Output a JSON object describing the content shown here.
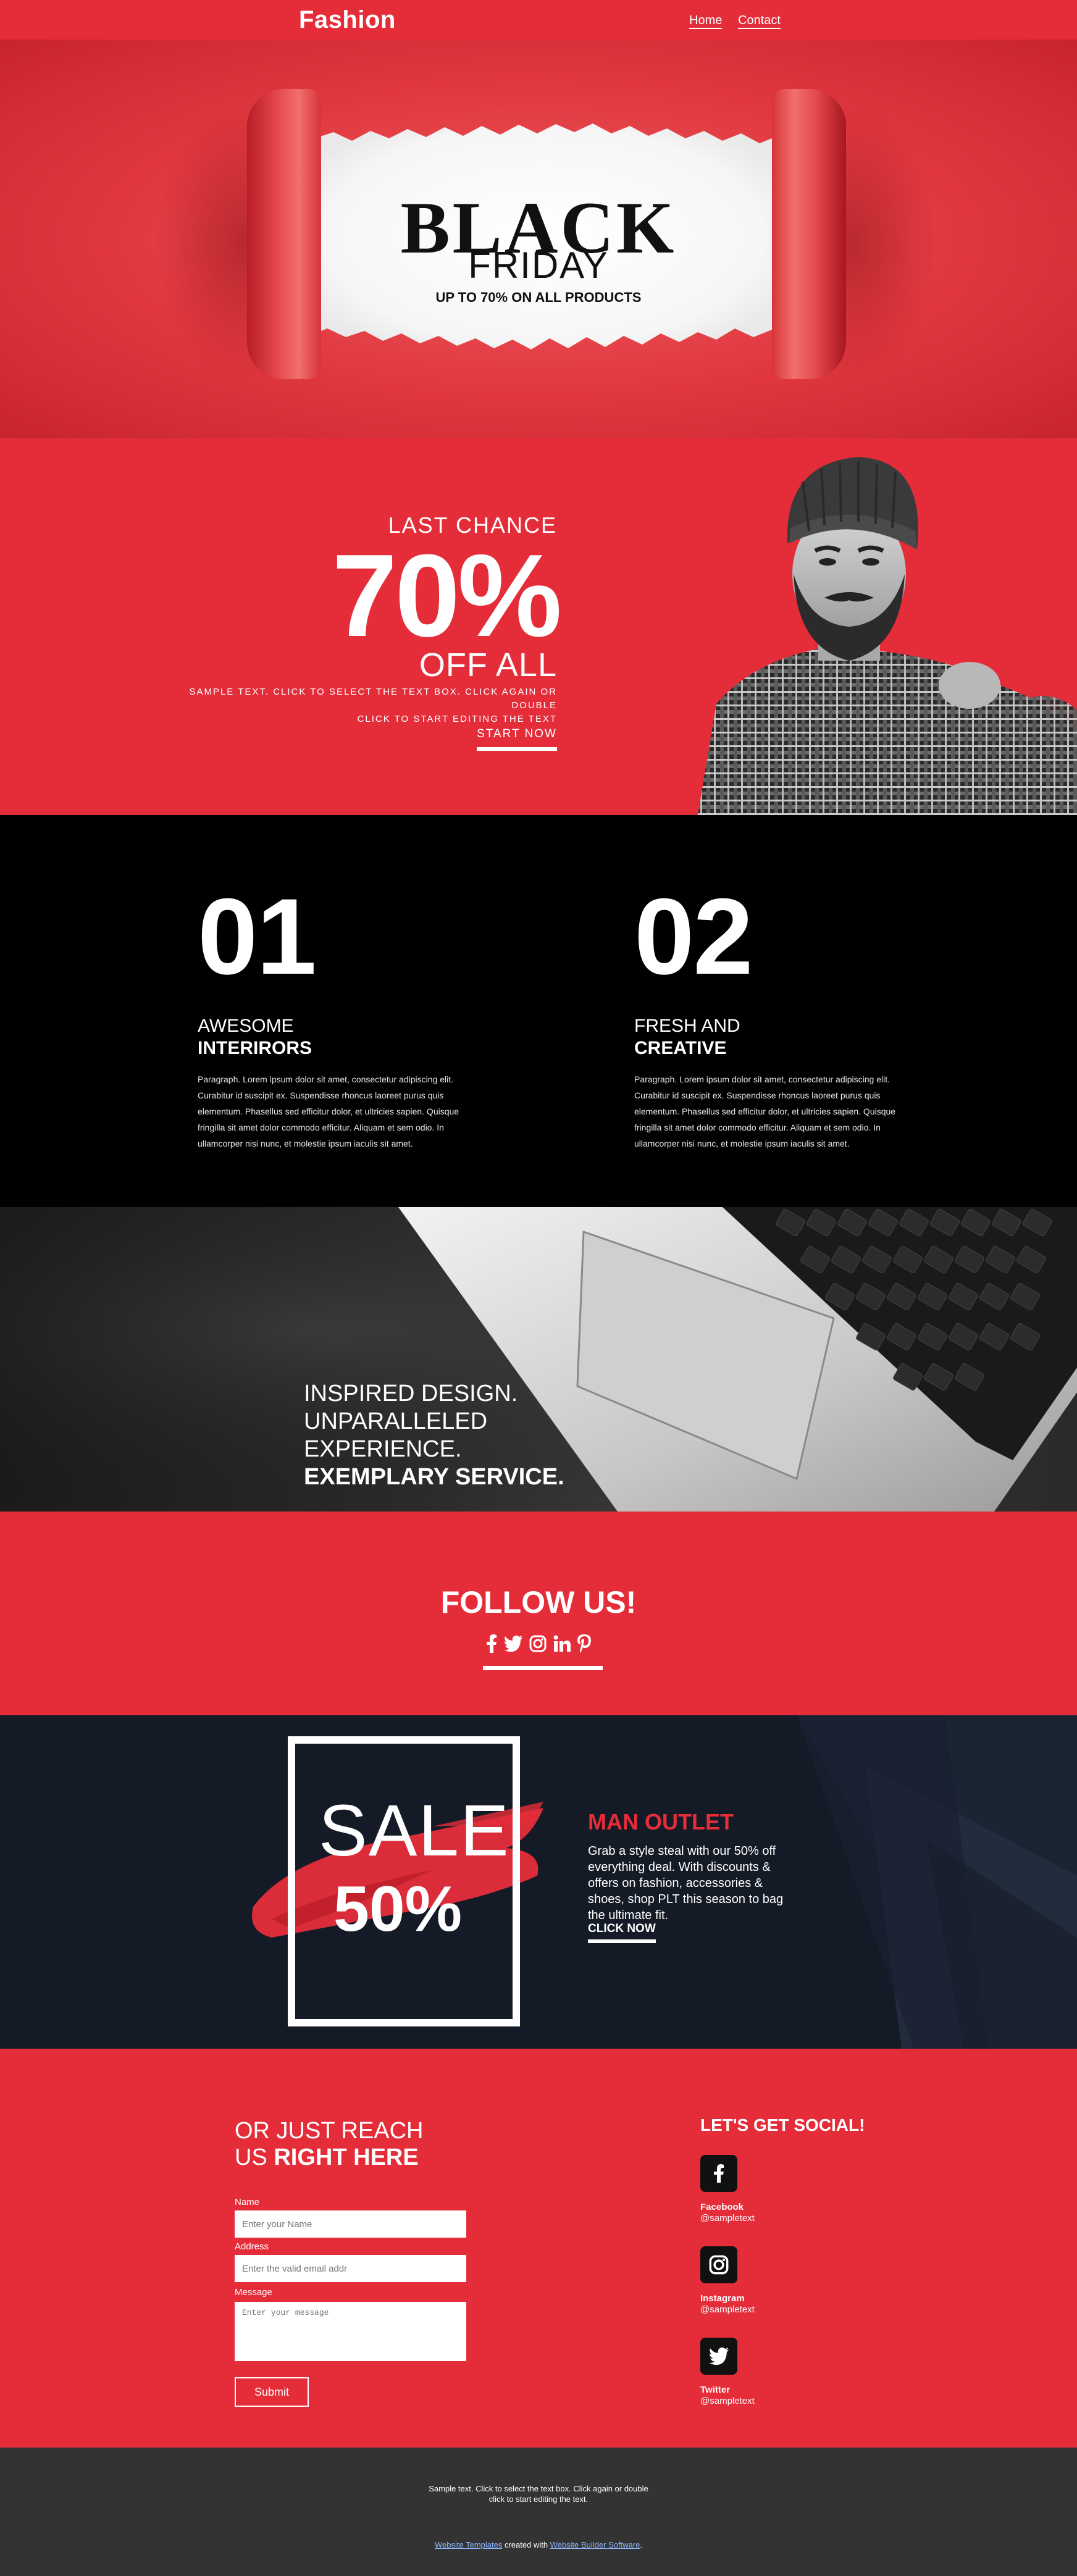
{
  "header": {
    "logo": "Fashion",
    "nav": [
      "Home",
      "Contact"
    ]
  },
  "hero": {
    "title": "BLACK",
    "subtitle": "FRIDAY",
    "tagline": "UP TO 70% ON ALL PRODUCTS"
  },
  "promo": {
    "last_chance": "LAST CHANCE",
    "percent": "70%",
    "off_all": "OFF ALL",
    "text_line1": "SAMPLE TEXT. CLICK TO SELECT THE TEXT BOX. CLICK AGAIN OR DOUBLE",
    "text_line2": "CLICK TO START EDITING THE TEXT",
    "button": "START NOW"
  },
  "features": [
    {
      "number": "01",
      "title1": "AWESOME",
      "title2": "INTERIRORS",
      "paragraph": "Paragraph. Lorem ipsum dolor sit amet, consectetur adipiscing elit. Curabitur id suscipit ex. Suspendisse rhoncus laoreet purus quis elementum. Phasellus sed efficitur dolor, et ultricies sapien. Quisque fringilla sit amet dolor commodo efficitur. Aliquam et sem odio. In ullamcorper nisi nunc, et molestie ipsum iaculis sit amet."
    },
    {
      "number": "02",
      "title1": "FRESH AND",
      "title2": "CREATIVE",
      "paragraph": "Paragraph. Lorem ipsum dolor sit amet, consectetur adipiscing elit. Curabitur id suscipit ex. Suspendisse rhoncus laoreet purus quis elementum. Phasellus sed efficitur dolor, et ultricies sapien. Quisque fringilla sit amet dolor commodo efficitur. Aliquam et sem odio. In ullamcorper nisi nunc, et molestie ipsum iaculis sit amet."
    }
  ],
  "inspired": {
    "line1": "INSPIRED DESIGN.",
    "line2": "UNPARALLELED",
    "line3": "EXPERIENCE.",
    "line4": "EXEMPLARY SERVICE."
  },
  "follow": {
    "title": "FOLLOW US!",
    "icons": [
      "facebook-icon",
      "twitter-icon",
      "instagram-icon",
      "linkedin-icon",
      "pinterest-icon"
    ]
  },
  "sale": {
    "word": "SALE",
    "percent": "50%",
    "title": "MAN OUTLET",
    "text": "Grab a style steal with our 50% off everything deal. With discounts & offers on fashion, accessories & shoes, shop PLT this season to bag the ultimate fit.",
    "button": "CLICK NOW"
  },
  "contact": {
    "heading_line1": "OR JUST REACH",
    "heading_line2_plain": "US ",
    "heading_line2_bold": "RIGHT HERE",
    "name_label": "Name",
    "name_placeholder": "Enter your Name",
    "email_label": "Address",
    "email_placeholder": "Enter the valid email addr",
    "message_label": "Message",
    "message_placeholder": "Enter your message",
    "submit": "Submit",
    "social_title": "LET'S GET SOCIAL!",
    "socials": [
      {
        "name": "Facebook",
        "handle": "@sampletext",
        "icon": "facebook-icon"
      },
      {
        "name": "Instagram",
        "handle": "@sampletext",
        "icon": "instagram-icon"
      },
      {
        "name": "Twitter",
        "handle": "@sampletext",
        "icon": "twitter-icon"
      }
    ]
  },
  "footer": {
    "text_line1": "Sample text. Click to select the text box. Click again or double",
    "text_line2": "click to start editing the text.",
    "credit_link1": "Website Templates",
    "credit_mid": " created with ",
    "credit_link2": "Website Builder Software",
    "credit_end": "."
  },
  "colors": {
    "brand_red": "#e52d3a",
    "dark": "#000000",
    "navy": "#141b27",
    "footer": "#333333"
  }
}
